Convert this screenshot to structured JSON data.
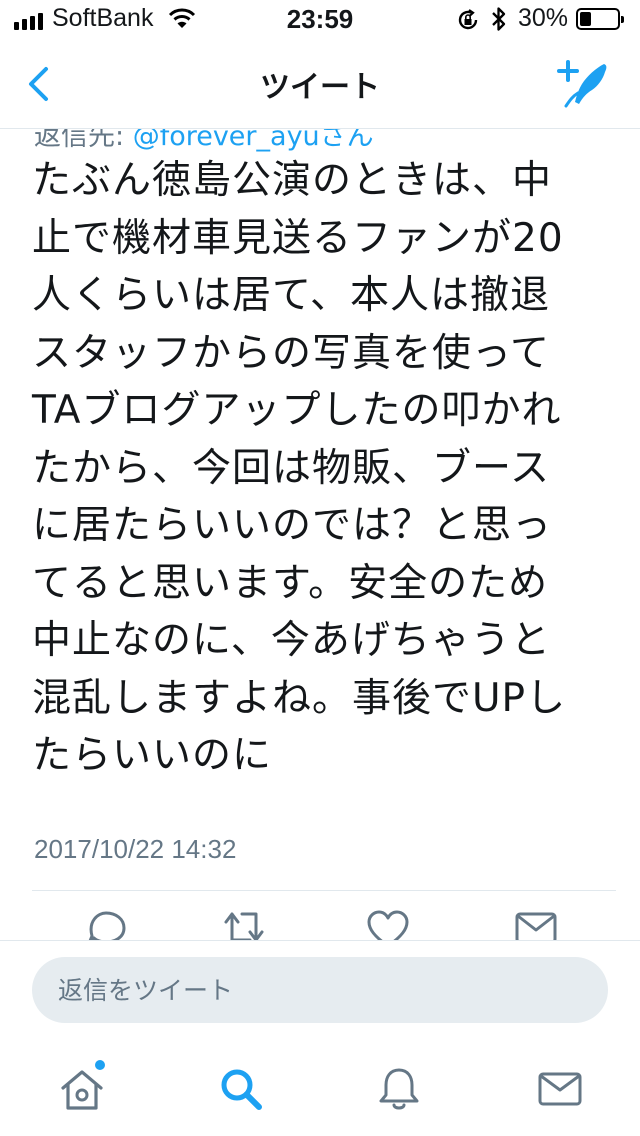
{
  "status_bar": {
    "carrier": "SoftBank",
    "time": "23:59",
    "battery_percent": "30%",
    "battery_level": 0.3
  },
  "nav": {
    "title": "ツイート"
  },
  "tweet": {
    "reply_to_prefix": "返信先: ",
    "reply_to_handle": "@forever_ayuさん",
    "text_lines": [
      "たぶん徳島公演のときは、中",
      "止で機材車見送るファンが20",
      "人くらいは居て、本人は撤退",
      "スタッフからの写真を使って",
      "TAブログアップしたの叩かれ",
      "たから、今回は物販、ブース",
      "に居たらいいのでは？と思っ",
      "てると思います。安全のため",
      "中止なのに、今あげちゃうと",
      "混乱しますよね。事後でUPし",
      "たらいいのに"
    ],
    "timestamp": "2017/10/22 14:32"
  },
  "reply_bar": {
    "placeholder": "返信をツイート"
  },
  "colors": {
    "accent": "#1da1f2",
    "text": "#14171a",
    "secondary_text": "#657786",
    "icon_gray": "#657786",
    "divider": "#e1e8ed",
    "input_bg": "#e6ecf0"
  },
  "icons": {
    "back": "chevron-left-icon",
    "compose": "compose-tweet-icon",
    "reply": "reply-icon",
    "retweet": "retweet-icon",
    "like": "heart-icon",
    "dm": "envelope-icon",
    "home": "home-icon",
    "search": "search-icon",
    "notifications": "bell-icon",
    "messages": "envelope-icon"
  }
}
